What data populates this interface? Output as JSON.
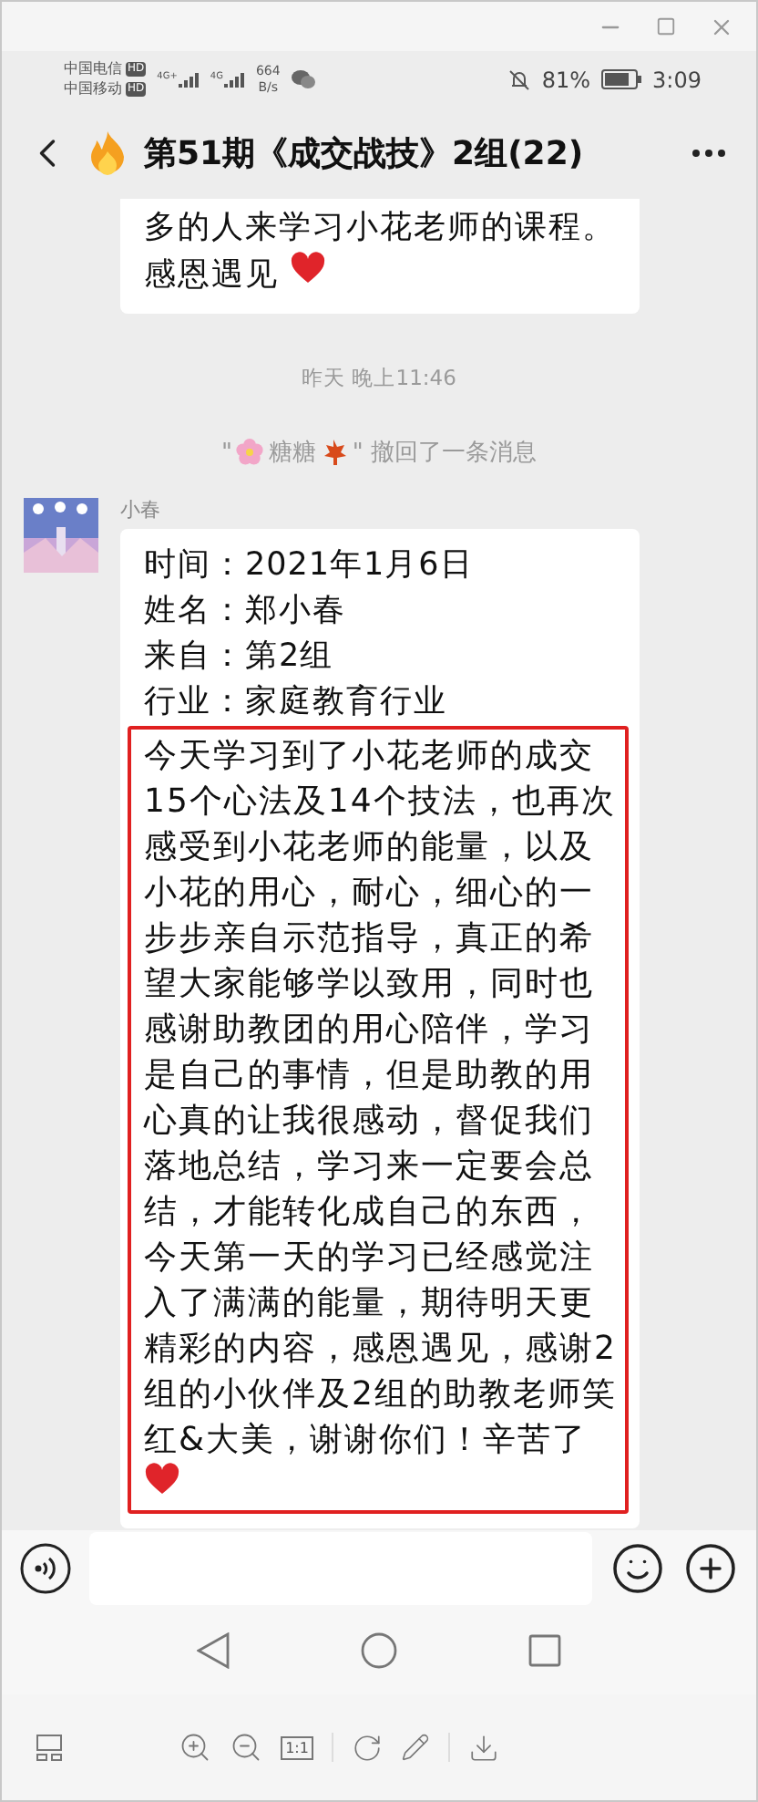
{
  "viewer": {
    "fit_label": "1:1"
  },
  "status_bar": {
    "carriers": [
      {
        "name": "中国电信",
        "badge": "HD"
      },
      {
        "name": "中国移动",
        "badge": "HD"
      }
    ],
    "signals": [
      {
        "label": "4G+"
      },
      {
        "label": "4G"
      }
    ],
    "speed": "664",
    "speed_unit": "B/s",
    "battery_percent": "81%",
    "time": "3:09"
  },
  "header": {
    "title": "第51期《成交战技》2组(22)"
  },
  "messages": [
    {
      "kind": "bubble",
      "lines": [
        "多的人来学习小花老师的课程。",
        "感恩遇见"
      ],
      "heart": true,
      "cut_top": true
    },
    {
      "kind": "time",
      "text": "昨天 晚上11:46"
    },
    {
      "kind": "recall",
      "quote_open": "\"",
      "name": "糖糖",
      "quote_close": "\"",
      "action": "撤回了一条消息"
    },
    {
      "kind": "bubble",
      "sender": "小春",
      "lines": [
        "时间：2021年1月6日",
        "姓名：郑小春",
        "来自：第2组",
        "行业：家庭教育行业"
      ],
      "highlight": "今天学习到了小花老师的成交15个心法及14个技法，也再次感受到小花老师的能量，以及小花的用心，耐心，细心的一步步亲自示范指导，真正的希望大家能够学以致用，同时也感谢助教团的用心陪伴，学习是自己的事情，但是助教的用心真的让我很感动，督促我们落地总结，学习来一定要会总结，才能转化成自己的东西，今天第一天的学习已经感觉注入了满满的能量，期待明天更精彩的内容，感恩遇见，感谢2组的小伙伴及2组的助教老师笑红&大美，谢谢你们！辛苦了",
      "heart": true,
      "cut_top": false
    }
  ]
}
